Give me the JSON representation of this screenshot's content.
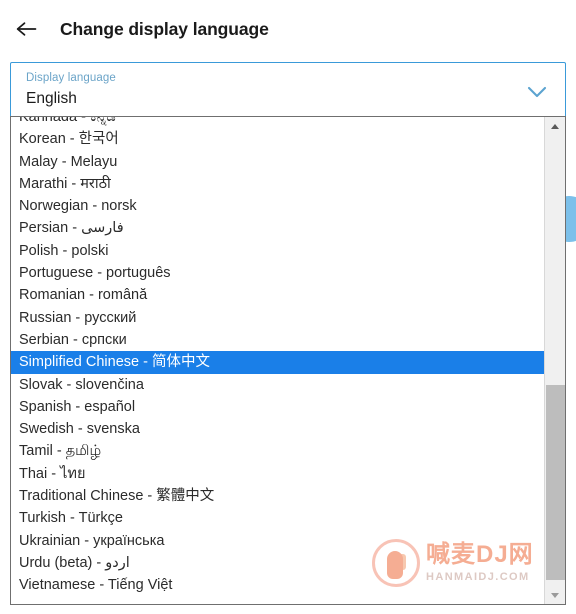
{
  "header": {
    "back_icon": "arrow-left-icon",
    "title": "Change display language"
  },
  "combobox": {
    "label": "Display language",
    "value": "English",
    "chevron_icon": "chevron-down-icon",
    "border_color": "#3a9ad9",
    "label_color": "#6ba4c8"
  },
  "listbox": {
    "selected_value": "Simplified Chinese - 简体中文",
    "highlight_color": "#1a7fe8",
    "options": [
      "Kannada - ಕನ್ನಡ",
      "Korean - 한국어",
      "Malay - Melayu",
      "Marathi - मराठी",
      "Norwegian - norsk",
      "Persian - فارسی",
      "Polish - polski",
      "Portuguese - português",
      "Romanian - română",
      "Russian - русский",
      "Serbian - српски",
      "Simplified Chinese - 简体中文",
      "Slovak - slovenčina",
      "Spanish - español",
      "Swedish - svenska",
      "Tamil - தமிழ்",
      "Thai - ไทย",
      "Traditional Chinese - 繁體中文",
      "Turkish - Türkçe",
      "Ukrainian - українська",
      "Urdu (beta) - اردو",
      "Vietnamese - Tiếng Việt"
    ]
  },
  "scrollbar": {
    "up_icon": "scroll-up-arrow-icon",
    "down_icon": "scroll-down-arrow-icon"
  },
  "watermark": {
    "chinese": "喊麦DJ网",
    "domain": "HANMAIDJ.COM"
  }
}
